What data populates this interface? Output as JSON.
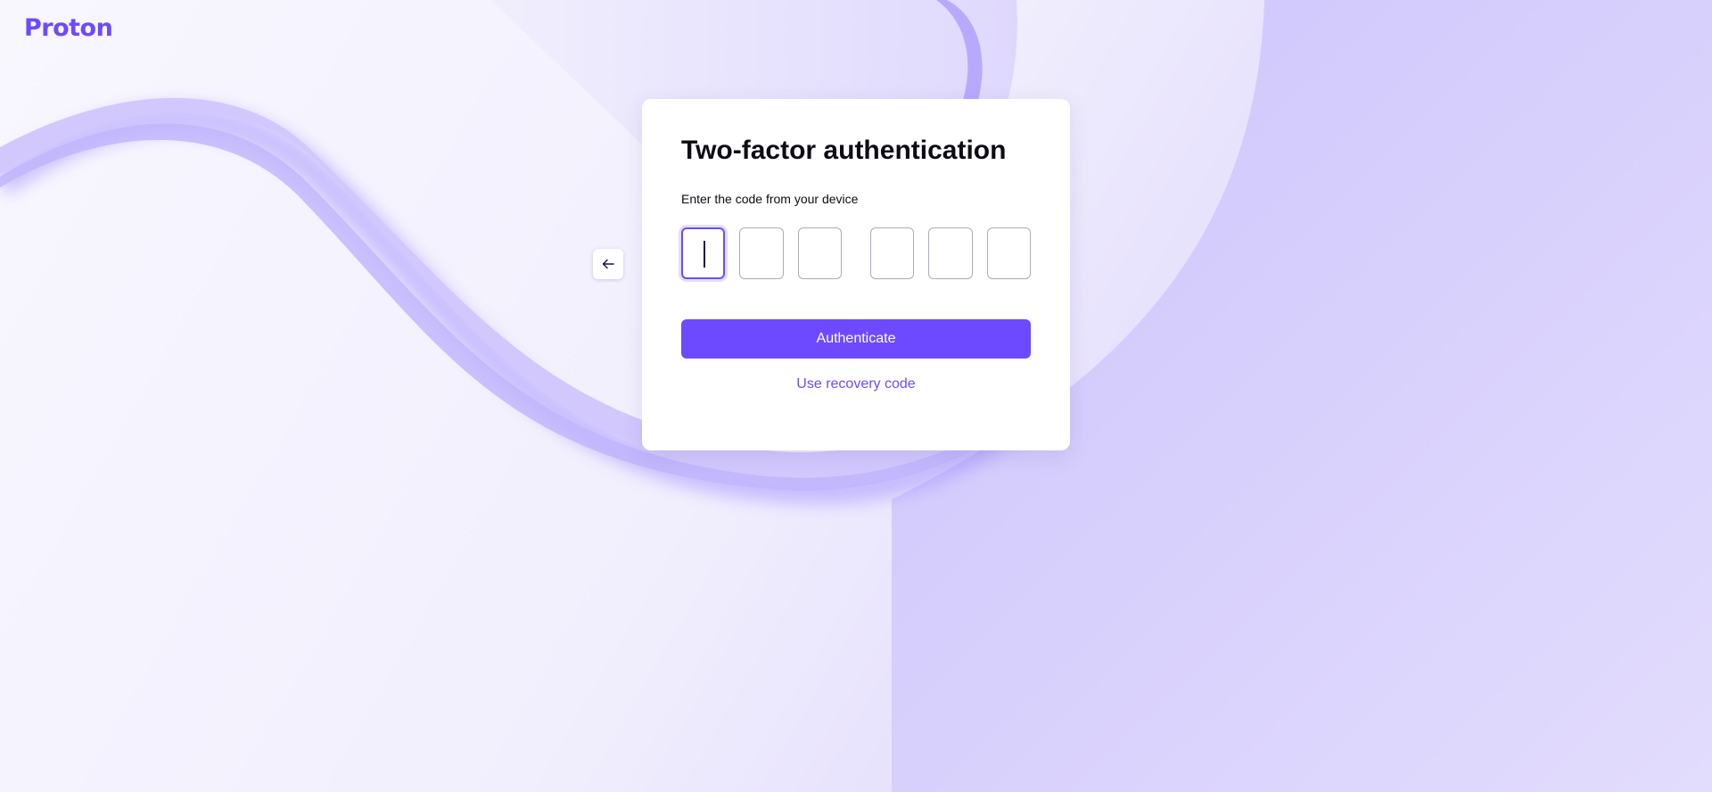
{
  "brand": {
    "logo_text": "Proton",
    "accent_color": "#6d4aff"
  },
  "back_button": {
    "icon": "arrow-left-icon"
  },
  "card": {
    "title": "Two-factor authentication",
    "subtitle": "Enter the code from your device",
    "code_fields": [
      "",
      "",
      "",
      "",
      "",
      ""
    ],
    "active_field_index": 0,
    "authenticate_label": "Authenticate",
    "recovery_link_label": "Use recovery code"
  }
}
